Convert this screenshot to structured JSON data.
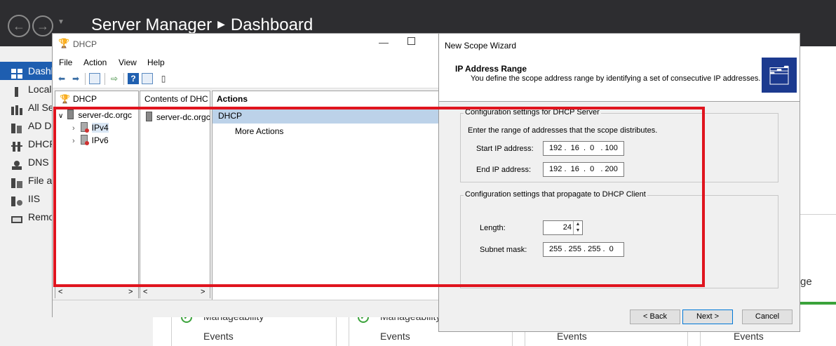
{
  "server_manager": {
    "title": "Server Manager",
    "page": "Dashboard",
    "sidebar": [
      {
        "label": "Dashb",
        "icon": "dashboard-icon",
        "active": true
      },
      {
        "label": "Local",
        "icon": "local-server-icon"
      },
      {
        "label": "All Se",
        "icon": "all-servers-icon"
      },
      {
        "label": "AD D",
        "icon": "ad-ds-icon"
      },
      {
        "label": "DHCP",
        "icon": "dhcp-icon"
      },
      {
        "label": "DNS",
        "icon": "dns-icon"
      },
      {
        "label": "File a",
        "icon": "file-services-icon"
      },
      {
        "label": "IIS",
        "icon": "iis-icon"
      },
      {
        "label": "Remo",
        "icon": "remote-access-icon"
      }
    ],
    "tiles": {
      "manageability_1": "Manageability",
      "manageability_2": "Manageability",
      "events_1": "Events",
      "events_2": "Events",
      "events_3": "Events",
      "events_4": "Events",
      "partial_label": "ge"
    }
  },
  "dhcp_window": {
    "title": "DHCP",
    "menu": [
      "File",
      "Action",
      "View",
      "Help"
    ],
    "tree_header": "DHCP",
    "tree": {
      "server": "server-dc.orgc",
      "ipv4": "IPv4",
      "ipv6": "IPv6"
    },
    "contents_header": "Contents of DHC",
    "contents_item": "server-dc.orgc",
    "actions_header": "Actions",
    "actions_selected": "DHCP",
    "actions_more": "More Actions"
  },
  "wizard": {
    "title": "New Scope Wizard",
    "heading": "IP Address Range",
    "subheading": "You define the scope address range by identifying a set of consecutive IP addresses.",
    "server_group": {
      "legend": "Configuration settings for DHCP Server",
      "instruction": "Enter the range of addresses that the scope distributes.",
      "start_label": "Start IP address:",
      "start_value": " 192 .  16  .  0   . 100",
      "end_label": "End IP address:",
      "end_value": " 192 .  16  .  0   . 200"
    },
    "client_group": {
      "legend": "Configuration settings that propagate to DHCP Client",
      "length_label": "Length:",
      "length_value": "24",
      "mask_label": "Subnet mask:",
      "mask_value": " 255 . 255 . 255 .  0"
    },
    "buttons": {
      "back": "< Back",
      "next": "Next >",
      "cancel": "Cancel"
    }
  },
  "colors": {
    "highlight": "#e0141e",
    "header": "#2d2d30",
    "active_nav": "#1e5eb0",
    "selected_action": "#bcd2e9"
  }
}
